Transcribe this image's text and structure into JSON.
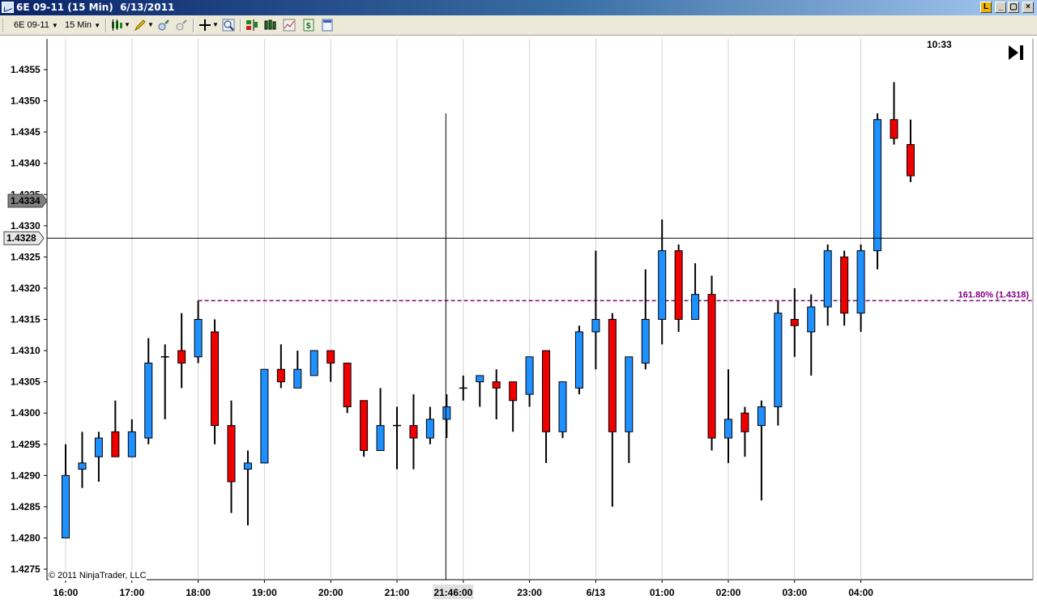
{
  "window": {
    "title": "6E 09-11 (15 Min)  6/13/2011",
    "buttons": [
      "L",
      "_",
      "▢",
      "×"
    ]
  },
  "toolbar": {
    "instrument": "6E 09-11",
    "interval": "15 Min"
  },
  "chart": {
    "clock": "10:33",
    "copyright": "© 2011 NinjaTrader, LLC",
    "price_marker_last": "1.4334",
    "price_marker_cursor": "1.4328",
    "cursor_time_label": "21:46:00",
    "fib_label": "161.80% (1.4318)",
    "colors": {
      "up": "#1e90ff",
      "down": "#ee0000",
      "fib": "#800080",
      "grid": "#d3d3d3"
    }
  },
  "chart_data": {
    "type": "candlestick",
    "y_ticks": [
      "1.4275",
      "1.4280",
      "1.4285",
      "1.4290",
      "1.4295",
      "1.4300",
      "1.4305",
      "1.4310",
      "1.4315",
      "1.4320",
      "1.4325",
      "1.4330",
      "1.4335",
      "1.4340",
      "1.4345",
      "1.4350",
      "1.4355"
    ],
    "ylim": [
      1.42725,
      1.43605
    ],
    "x_labels": [
      "16:00",
      "17:00",
      "18:00",
      "19:00",
      "20:00",
      "21:00",
      "22:00",
      "23:00",
      "6/13",
      "01:00",
      "02:00",
      "03:00",
      "04:00"
    ],
    "cursor_price": 1.4328,
    "cursor_bar_index": 23,
    "fib_level": 1.4318,
    "fib_start_index": 8,
    "candles": [
      {
        "o": 1.428,
        "h": 1.4295,
        "l": 1.428,
        "c": 1.429
      },
      {
        "o": 1.4291,
        "h": 1.4297,
        "l": 1.4288,
        "c": 1.4292
      },
      {
        "o": 1.4293,
        "h": 1.4297,
        "l": 1.4289,
        "c": 1.4296
      },
      {
        "o": 1.4297,
        "h": 1.4302,
        "l": 1.4293,
        "c": 1.4293
      },
      {
        "o": 1.4293,
        "h": 1.4299,
        "l": 1.4293,
        "c": 1.4297
      },
      {
        "o": 1.4296,
        "h": 1.4312,
        "l": 1.4295,
        "c": 1.4308
      },
      {
        "o": 1.4309,
        "h": 1.4311,
        "l": 1.4299,
        "c": 1.4309
      },
      {
        "o": 1.431,
        "h": 1.4316,
        "l": 1.4304,
        "c": 1.4308
      },
      {
        "o": 1.4309,
        "h": 1.4318,
        "l": 1.4308,
        "c": 1.4315
      },
      {
        "o": 1.4313,
        "h": 1.4315,
        "l": 1.4295,
        "c": 1.4298
      },
      {
        "o": 1.4298,
        "h": 1.4302,
        "l": 1.4284,
        "c": 1.4289
      },
      {
        "o": 1.4291,
        "h": 1.4294,
        "l": 1.4282,
        "c": 1.4292
      },
      {
        "o": 1.4292,
        "h": 1.4307,
        "l": 1.4292,
        "c": 1.4307
      },
      {
        "o": 1.4307,
        "h": 1.4311,
        "l": 1.4304,
        "c": 1.4305
      },
      {
        "o": 1.4304,
        "h": 1.431,
        "l": 1.4304,
        "c": 1.4307
      },
      {
        "o": 1.4306,
        "h": 1.431,
        "l": 1.4306,
        "c": 1.431
      },
      {
        "o": 1.431,
        "h": 1.431,
        "l": 1.4305,
        "c": 1.4308
      },
      {
        "o": 1.4308,
        "h": 1.4308,
        "l": 1.43,
        "c": 1.4301
      },
      {
        "o": 1.4302,
        "h": 1.4302,
        "l": 1.4293,
        "c": 1.4294
      },
      {
        "o": 1.4294,
        "h": 1.4304,
        "l": 1.4294,
        "c": 1.4298
      },
      {
        "o": 1.4298,
        "h": 1.4301,
        "l": 1.4291,
        "c": 1.4298
      },
      {
        "o": 1.4298,
        "h": 1.4303,
        "l": 1.4291,
        "c": 1.4296
      },
      {
        "o": 1.4296,
        "h": 1.4301,
        "l": 1.4295,
        "c": 1.4299
      },
      {
        "o": 1.4299,
        "h": 1.4303,
        "l": 1.4296,
        "c": 1.4301
      },
      {
        "o": 1.4304,
        "h": 1.4306,
        "l": 1.4302,
        "c": 1.4304
      },
      {
        "o": 1.4305,
        "h": 1.4306,
        "l": 1.4301,
        "c": 1.4306
      },
      {
        "o": 1.4305,
        "h": 1.4307,
        "l": 1.4299,
        "c": 1.4304
      },
      {
        "o": 1.4305,
        "h": 1.4305,
        "l": 1.4297,
        "c": 1.4302
      },
      {
        "o": 1.4303,
        "h": 1.4309,
        "l": 1.4301,
        "c": 1.4309
      },
      {
        "o": 1.431,
        "h": 1.431,
        "l": 1.4292,
        "c": 1.4297
      },
      {
        "o": 1.4297,
        "h": 1.4305,
        "l": 1.4296,
        "c": 1.4305
      },
      {
        "o": 1.4304,
        "h": 1.4314,
        "l": 1.4303,
        "c": 1.4313
      },
      {
        "o": 1.4313,
        "h": 1.4326,
        "l": 1.4307,
        "c": 1.4315
      },
      {
        "o": 1.4315,
        "h": 1.4316,
        "l": 1.4285,
        "c": 1.4297
      },
      {
        "o": 1.4297,
        "h": 1.4309,
        "l": 1.4292,
        "c": 1.4309
      },
      {
        "o": 1.4308,
        "h": 1.4323,
        "l": 1.4307,
        "c": 1.4315
      },
      {
        "o": 1.4315,
        "h": 1.4331,
        "l": 1.4311,
        "c": 1.4326
      },
      {
        "o": 1.4326,
        "h": 1.4327,
        "l": 1.4313,
        "c": 1.4315
      },
      {
        "o": 1.4315,
        "h": 1.4324,
        "l": 1.4315,
        "c": 1.4319
      },
      {
        "o": 1.4319,
        "h": 1.4322,
        "l": 1.4294,
        "c": 1.4296
      },
      {
        "o": 1.4296,
        "h": 1.4307,
        "l": 1.4292,
        "c": 1.4299
      },
      {
        "o": 1.43,
        "h": 1.4301,
        "l": 1.4293,
        "c": 1.4297
      },
      {
        "o": 1.4298,
        "h": 1.4302,
        "l": 1.4286,
        "c": 1.4301
      },
      {
        "o": 1.4301,
        "h": 1.4318,
        "l": 1.4298,
        "c": 1.4316
      },
      {
        "o": 1.4315,
        "h": 1.432,
        "l": 1.4309,
        "c": 1.4314
      },
      {
        "o": 1.4313,
        "h": 1.4319,
        "l": 1.4306,
        "c": 1.4317
      },
      {
        "o": 1.4317,
        "h": 1.4327,
        "l": 1.4314,
        "c": 1.4326
      },
      {
        "o": 1.4325,
        "h": 1.4326,
        "l": 1.4314,
        "c": 1.4316
      },
      {
        "o": 1.4316,
        "h": 1.4327,
        "l": 1.4313,
        "c": 1.4326
      },
      {
        "o": 1.4326,
        "h": 1.4348,
        "l": 1.4323,
        "c": 1.4347
      },
      {
        "o": 1.4347,
        "h": 1.4353,
        "l": 1.4343,
        "c": 1.4344
      },
      {
        "o": 1.4343,
        "h": 1.4347,
        "l": 1.4337,
        "c": 1.4338
      }
    ]
  }
}
